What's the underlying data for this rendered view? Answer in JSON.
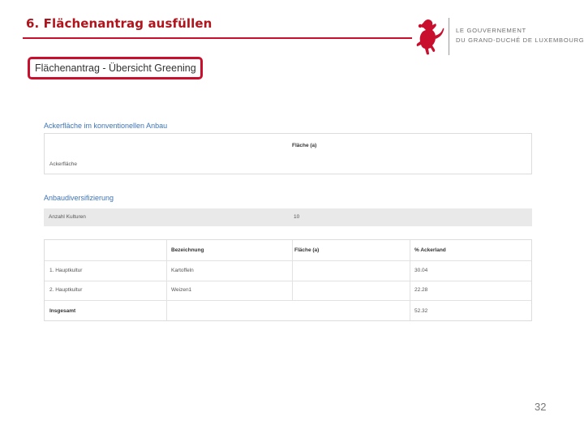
{
  "slide": {
    "title": "6. Flächenantrag ausfüllen",
    "page_number": "32"
  },
  "logo": {
    "line1": "LE GOUVERNEMENT",
    "line2": "DU GRAND-DUCHÉ DE LUXEMBOURG"
  },
  "app": {
    "header": "Flächenantrag - Übersicht Greening"
  },
  "section1": {
    "title": "Ackerfläche im konventionellen Anbau",
    "column_header": "Fläche (a)",
    "row_label": "Ackerfläche",
    "row_value": ""
  },
  "section2": {
    "title": "Anbaudiversifizierung",
    "summary_label": "Anzahl Kulturen",
    "summary_value": "10",
    "table": {
      "headers": [
        "",
        "Bezeichnung",
        "Fläche (a)",
        "% Ackerland"
      ],
      "rows": [
        [
          "1. Hauptkultur",
          "Kartoffeln",
          "",
          "30.04"
        ],
        [
          "2. Hauptkultur",
          "Weizen1",
          "",
          "22.28"
        ]
      ],
      "total": [
        "Insgesamt",
        "",
        "",
        "52.32"
      ]
    }
  },
  "colors": {
    "title": "#b0141c",
    "accent_red": "#c8102e",
    "section_blue": "#3e74b4"
  }
}
